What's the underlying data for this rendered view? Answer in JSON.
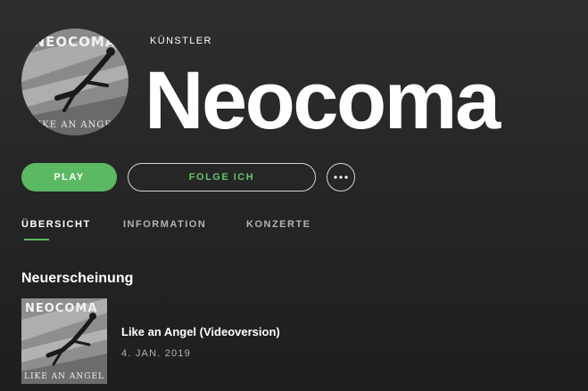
{
  "artist": {
    "kind_label": "KÜNSTLER",
    "name": "Neocoma",
    "image_text": "NEOCOMA",
    "image_subtext": "LIKE AN ANGEL"
  },
  "actions": {
    "play_label": "PLAY",
    "follow_label": "FOLGE ICH",
    "more_icon": "ellipsis-icon"
  },
  "tabs": [
    {
      "label": "ÜBERSICHT",
      "active": true
    },
    {
      "label": "INFORMATION",
      "active": false
    },
    {
      "label": "KONZERTE",
      "active": false
    }
  ],
  "section": {
    "title": "Neuerscheinung"
  },
  "release": {
    "title": "Like an Angel (Videoversion)",
    "date": "4. JAN. 2019",
    "cover_text": "NEOCOMA",
    "cover_subtext": "LIKE AN ANGEL"
  },
  "colors": {
    "accent": "#5cb963",
    "background": "#262626"
  }
}
